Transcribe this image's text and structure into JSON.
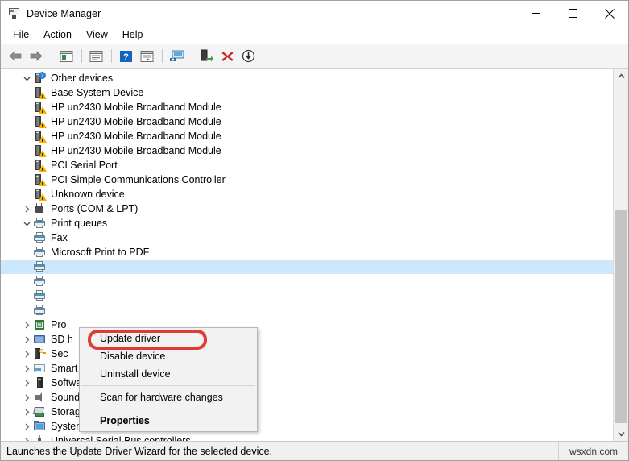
{
  "window": {
    "title": "Device Manager",
    "icon": "device-manager-icon",
    "controls": {
      "minimize": "minimize-icon",
      "maximize": "maximize-icon",
      "close": "close-icon"
    }
  },
  "menubar": {
    "items": [
      {
        "label": "File"
      },
      {
        "label": "Action"
      },
      {
        "label": "View"
      },
      {
        "label": "Help"
      }
    ]
  },
  "toolbar": {
    "buttons": [
      {
        "name": "back-arrow-icon",
        "tooltip": "Back"
      },
      {
        "name": "forward-arrow-icon",
        "tooltip": "Forward"
      },
      {
        "name": "show-hide-console-tree-icon",
        "tooltip": "Show/Hide console tree"
      },
      {
        "name": "properties-icon",
        "tooltip": "Properties"
      },
      {
        "name": "help-icon",
        "tooltip": "Help"
      },
      {
        "name": "view-details-icon",
        "tooltip": "View"
      },
      {
        "name": "scan-hardware-changes-icon",
        "tooltip": "Scan for hardware changes"
      },
      {
        "name": "update-driver-icon",
        "tooltip": "Update driver"
      },
      {
        "name": "uninstall-device-icon",
        "tooltip": "Uninstall device"
      },
      {
        "name": "disable-device-icon",
        "tooltip": "Disable device"
      }
    ]
  },
  "tree": {
    "rows": [
      {
        "label": "Other devices",
        "depth": 0,
        "expander": "expanded",
        "icon": "unknown-device-icon",
        "badge": "question"
      },
      {
        "label": "Base System Device",
        "depth": 1,
        "expander": "none",
        "icon": "device-icon",
        "badge": "warning"
      },
      {
        "label": "HP un2430 Mobile Broadband Module",
        "depth": 1,
        "expander": "none",
        "icon": "device-icon",
        "badge": "warning"
      },
      {
        "label": "HP un2430 Mobile Broadband Module",
        "depth": 1,
        "expander": "none",
        "icon": "device-icon",
        "badge": "warning"
      },
      {
        "label": "HP un2430 Mobile Broadband Module",
        "depth": 1,
        "expander": "none",
        "icon": "device-icon",
        "badge": "warning"
      },
      {
        "label": "HP un2430 Mobile Broadband Module",
        "depth": 1,
        "expander": "none",
        "icon": "device-icon",
        "badge": "warning"
      },
      {
        "label": "PCI Serial Port",
        "depth": 1,
        "expander": "none",
        "icon": "device-icon",
        "badge": "warning"
      },
      {
        "label": "PCI Simple Communications Controller",
        "depth": 1,
        "expander": "none",
        "icon": "device-icon",
        "badge": "warning"
      },
      {
        "label": "Unknown device",
        "depth": 1,
        "expander": "none",
        "icon": "device-icon",
        "badge": "warning"
      },
      {
        "label": "Ports (COM & LPT)",
        "depth": 0,
        "expander": "collapsed",
        "icon": "port-icon",
        "badge": "none"
      },
      {
        "label": "Print queues",
        "depth": 0,
        "expander": "expanded",
        "icon": "printer-icon",
        "badge": "none"
      },
      {
        "label": "Fax",
        "depth": 1,
        "expander": "none",
        "icon": "printer-icon",
        "badge": "none"
      },
      {
        "label": "Microsoft Print to PDF",
        "depth": 1,
        "expander": "none",
        "icon": "printer-icon",
        "badge": "none"
      },
      {
        "label": "",
        "depth": 1,
        "expander": "none",
        "icon": "printer-icon",
        "badge": "none",
        "selected": true
      },
      {
        "label": "",
        "depth": 1,
        "expander": "none",
        "icon": "printer-icon",
        "badge": "none"
      },
      {
        "label": "",
        "depth": 1,
        "expander": "none",
        "icon": "printer-icon",
        "badge": "none"
      },
      {
        "label": "",
        "depth": 1,
        "expander": "none",
        "icon": "printer-icon",
        "badge": "none"
      },
      {
        "label": "Pro",
        "depth": 0,
        "expander": "collapsed",
        "icon": "processor-icon",
        "badge": "none"
      },
      {
        "label": "SD h",
        "depth": 0,
        "expander": "collapsed",
        "icon": "sd-host-icon",
        "badge": "none"
      },
      {
        "label": "Sec",
        "depth": 0,
        "expander": "collapsed",
        "icon": "security-device-icon",
        "badge": "none"
      },
      {
        "label": "Smart card readers",
        "depth": 0,
        "expander": "collapsed",
        "icon": "smart-card-reader-icon",
        "badge": "none"
      },
      {
        "label": "Software devices",
        "depth": 0,
        "expander": "collapsed",
        "icon": "software-device-icon",
        "badge": "none"
      },
      {
        "label": "Sound, video and game controllers",
        "depth": 0,
        "expander": "collapsed",
        "icon": "sound-icon",
        "badge": "none"
      },
      {
        "label": "Storage controllers",
        "depth": 0,
        "expander": "collapsed",
        "icon": "storage-controller-icon",
        "badge": "none"
      },
      {
        "label": "System devices",
        "depth": 0,
        "expander": "collapsed",
        "icon": "system-device-icon",
        "badge": "none"
      },
      {
        "label": "Universal Serial Bus controllers",
        "depth": 0,
        "expander": "collapsed",
        "icon": "usb-icon",
        "badge": "none"
      }
    ]
  },
  "context_menu": {
    "items": [
      {
        "label": "Update driver",
        "highlighted": true,
        "bold": false
      },
      {
        "label": "Disable device",
        "highlighted": false,
        "bold": false
      },
      {
        "label": "Uninstall device",
        "highlighted": false,
        "bold": false
      },
      {
        "label": "Scan for hardware changes",
        "highlighted": false,
        "bold": false
      },
      {
        "label": "Properties",
        "highlighted": false,
        "bold": true
      }
    ],
    "highlight_color": "#e03a32"
  },
  "statusbar": {
    "text": "Launches the Update Driver Wizard for the selected device.",
    "right_text": "wsxdn.com"
  },
  "scrollbar": {
    "up_arrow": "scroll-up-icon",
    "down_arrow": "scroll-down-icon"
  }
}
